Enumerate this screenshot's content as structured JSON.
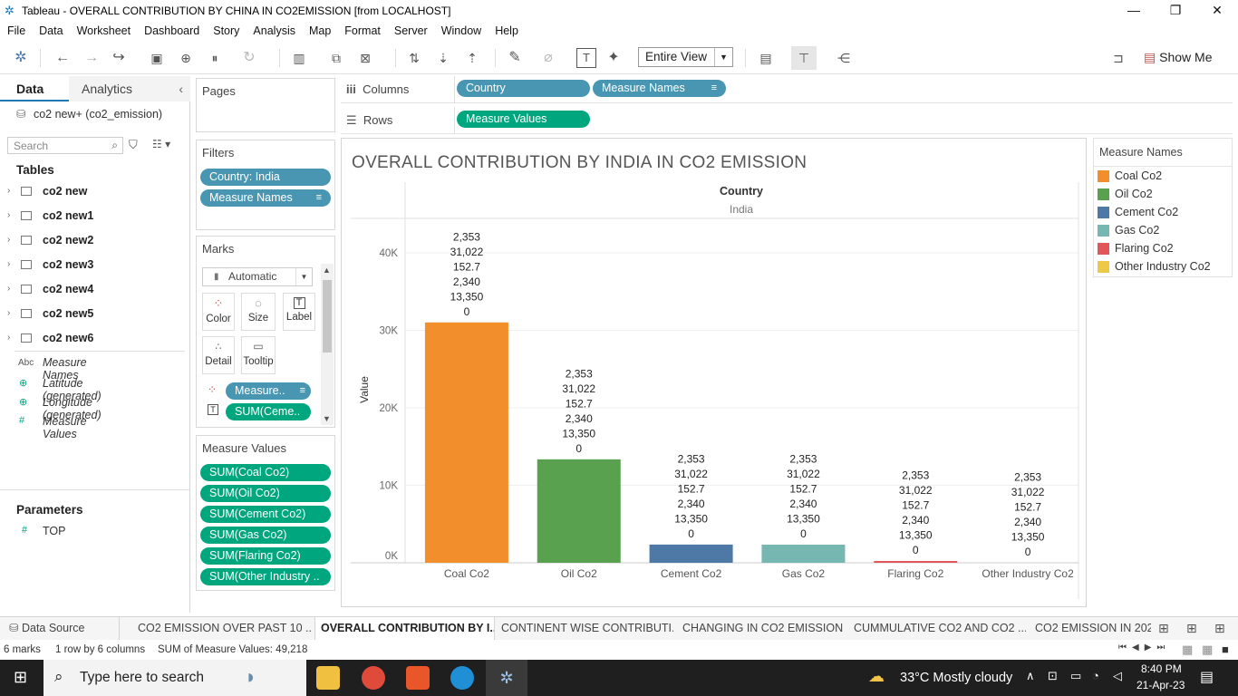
{
  "window": {
    "title": "Tableau - OVERALL CONTRIBUTION BY CHINA IN CO2EMISSION [from LOCALHOST]"
  },
  "menu": [
    "File",
    "Data",
    "Worksheet",
    "Dashboard",
    "Story",
    "Analysis",
    "Map",
    "Format",
    "Server",
    "Window",
    "Help"
  ],
  "toolbar": {
    "view_mode": "Entire View",
    "show_me": "Show Me"
  },
  "data_pane": {
    "tab_data": "Data",
    "tab_analytics": "Analytics",
    "datasource": "co2 new+ (co2_emission)",
    "search_placeholder": "Search",
    "tables_heading": "Tables",
    "tables": [
      "co2 new",
      "co2 new1",
      "co2 new2",
      "co2 new3",
      "co2 new4",
      "co2 new5",
      "co2 new6"
    ],
    "fields": [
      {
        "icon": "Abc",
        "name": "Measure Names"
      },
      {
        "icon": "globe",
        "name": "Latitude (generated)"
      },
      {
        "icon": "globe",
        "name": "Longitude (generated)"
      },
      {
        "icon": "#",
        "name": "Measure Values"
      }
    ],
    "parameters_heading": "Parameters",
    "parameters": [
      "TOP"
    ]
  },
  "pages_card": {
    "title": "Pages"
  },
  "filters_card": {
    "title": "Filters",
    "pills": [
      "Country: India",
      "Measure Names"
    ]
  },
  "marks_card": {
    "title": "Marks",
    "mark_type": "Automatic",
    "buttons": [
      "Color",
      "Size",
      "Label",
      "Detail",
      "Tooltip"
    ],
    "pills": [
      "Measure..",
      "SUM(Ceme.."
    ]
  },
  "measure_values_card": {
    "title": "Measure Values",
    "pills": [
      "SUM(Coal Co2)",
      "SUM(Oil Co2)",
      "SUM(Cement Co2)",
      "SUM(Gas Co2)",
      "SUM(Flaring Co2)",
      "SUM(Other Industry .."
    ]
  },
  "shelves": {
    "columns_label": "Columns",
    "columns_pills": [
      "Country",
      "Measure Names"
    ],
    "rows_label": "Rows",
    "rows_pills": [
      "Measure Values"
    ]
  },
  "legend": {
    "title": "Measure Names",
    "items": [
      {
        "label": "Coal Co2",
        "color": "#f28e2b"
      },
      {
        "label": "Oil Co2",
        "color": "#59a14f"
      },
      {
        "label": "Cement Co2",
        "color": "#4e79a7"
      },
      {
        "label": "Gas Co2",
        "color": "#76b7b2"
      },
      {
        "label": "Flaring Co2",
        "color": "#e15759"
      },
      {
        "label": "Other Industry Co2",
        "color": "#edc948"
      }
    ]
  },
  "chart_data": {
    "type": "bar",
    "title": "OVERALL CONTRIBUTION BY INDIA IN CO2 EMISSION",
    "header_field": "Country",
    "header_value": "India",
    "ylabel": "Value",
    "ylim": [
      0,
      45000
    ],
    "yticks": [
      0,
      10000,
      20000,
      30000,
      40000
    ],
    "ytick_labels": [
      "0K",
      "10K",
      "20K",
      "30K",
      "40K"
    ],
    "categories": [
      "Coal Co2",
      "Oil Co2",
      "Cement Co2",
      "Gas Co2",
      "Flaring Co2",
      "Other Industry Co2"
    ],
    "values": [
      31022,
      13350,
      2353,
      2340,
      152.7,
      0
    ],
    "colors": [
      "#f28e2b",
      "#59a14f",
      "#4e79a7",
      "#76b7b2",
      "#e15759",
      "#edc948"
    ],
    "bar_label_lines": [
      "2,353",
      "31,022",
      "152.7",
      "2,340",
      "13,350",
      "0"
    ],
    "grid": true
  },
  "sheet_tabs": {
    "data_source": "Data Source",
    "tabs": [
      "CO2 EMISSION OVER PAST 10 ...",
      "OVERALL CONTRIBUTION BY I...",
      "CONTINENT WISE CONTRIBUTI...",
      "CHANGING IN CO2 EMISSION",
      "CUMMULATIVE CO2 AND CO2 ...",
      "CO2 EMISSION IN 2020"
    ],
    "active_index": 1
  },
  "status": {
    "marks": "6 marks",
    "layout": "1 row by 6 columns",
    "sum": "SUM of Measure Values: 49,218"
  },
  "taskbar": {
    "search_placeholder": "Type here to search",
    "weather": "33°C  Mostly cloudy",
    "time": "8:40 PM",
    "date": "21-Apr-23"
  }
}
